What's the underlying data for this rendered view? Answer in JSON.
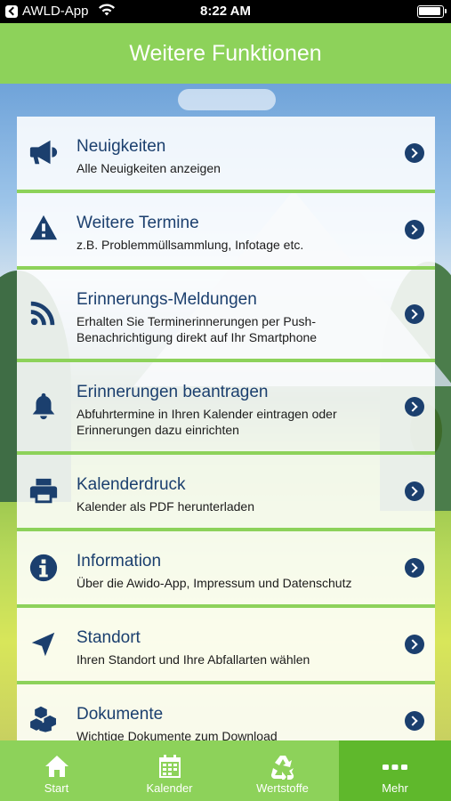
{
  "status_bar": {
    "carrier": "AWLD-App",
    "time": "8:22 AM"
  },
  "header": {
    "title": "Weitere Funktionen"
  },
  "menu": [
    {
      "icon": "megaphone-icon",
      "title": "Neuigkeiten",
      "subtitle": "Alle Neuigkeiten anzeigen"
    },
    {
      "icon": "warning-icon",
      "title": "Weitere Termine",
      "subtitle": "z.B. Problemmüllsammlung, Infotage etc."
    },
    {
      "icon": "rss-icon",
      "title": "Erinnerungs-Meldungen",
      "subtitle": "Erhalten Sie Terminerinnerungen per Push-Benachrichtigung direkt auf Ihr Smartphone"
    },
    {
      "icon": "bell-icon",
      "title": "Erinnerungen beantragen",
      "subtitle": "Abfuhrtermine in Ihren Kalender eintragen oder Erinnerungen dazu einrichten"
    },
    {
      "icon": "printer-icon",
      "title": "Kalenderdruck",
      "subtitle": "Kalender als PDF herunterladen"
    },
    {
      "icon": "info-icon",
      "title": "Information",
      "subtitle": "Über die Awido-App, Impressum und Datenschutz"
    },
    {
      "icon": "location-arrow-icon",
      "title": "Standort",
      "subtitle": "Ihren Standort und Ihre Abfallarten wählen"
    },
    {
      "icon": "cubes-icon",
      "title": "Dokumente",
      "subtitle": "Wichtige Dokumente zum Download"
    }
  ],
  "tabs": [
    {
      "icon": "home-icon",
      "label": "Start"
    },
    {
      "icon": "calendar-icon",
      "label": "Kalender"
    },
    {
      "icon": "recycle-icon",
      "label": "Wertstoffe"
    },
    {
      "icon": "more-dots-icon",
      "label": "Mehr",
      "active": true
    }
  ],
  "colors": {
    "accent": "#8dd25a",
    "active_tab": "#5fb82c",
    "primary_text": "#1b3f6e"
  }
}
